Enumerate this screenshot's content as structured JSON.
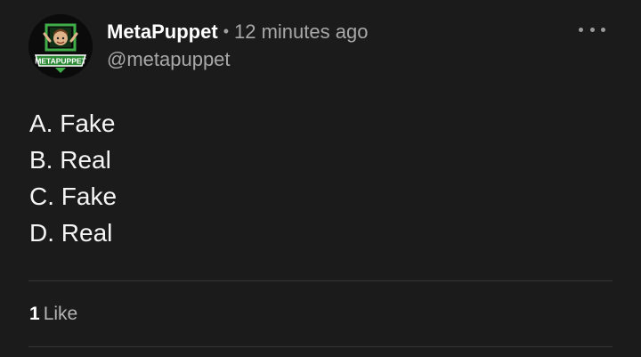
{
  "post": {
    "author": "MetaPuppet",
    "separator": "•",
    "time": "12 minutes ago",
    "handle": "@metapuppet",
    "avatar_text": "METAPUPPET",
    "menu_icon": "more-horizontal-icon",
    "lines": [
      "A. Fake",
      "B. Real",
      "C. Fake",
      "D. Real"
    ],
    "like_count": "1",
    "like_label": "Like"
  },
  "colors": {
    "background": "#1b1b1b",
    "text": "#f2f2f2",
    "muted": "#a8a8a8",
    "avatar_accent": "#3fae49"
  }
}
